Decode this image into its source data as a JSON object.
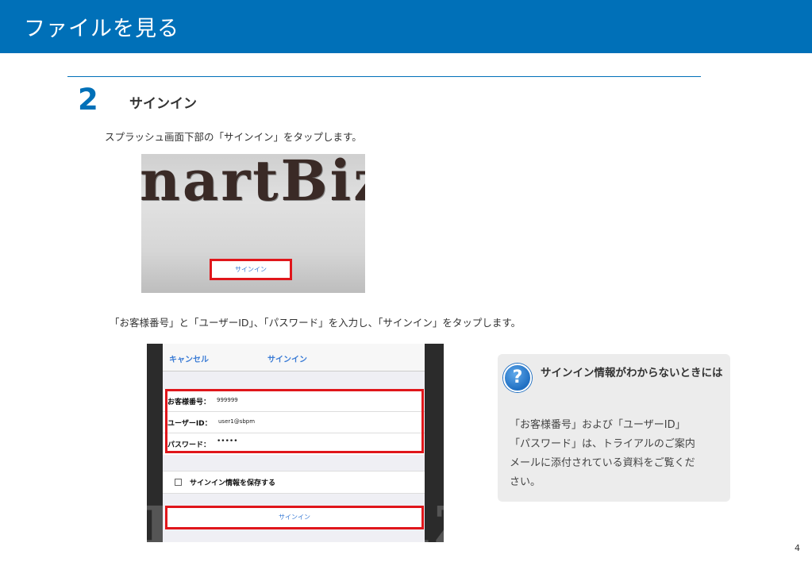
{
  "header": {
    "title": "ファイルを見る"
  },
  "step": {
    "number": "2",
    "title": "サインイン"
  },
  "para1": "スプラッシュ画面下部の「サインイン」をタップします。",
  "splash": {
    "logo_text": "nartBiz",
    "signin_label": "サインイン"
  },
  "para2": "「お客様番号」と「ユーザーID」、「パスワード」を入力し、「サインイン」をタップします。",
  "signin_screen": {
    "cancel": "キャンセル",
    "title": "サインイン",
    "customer_label": "お客様番号：",
    "customer_value": "999999",
    "user_label": "ユーザーID：",
    "user_value": "user1@sbpm",
    "password_label": "パスワード：",
    "password_value": "•••••",
    "remember_label": "サインイン情報を保存する",
    "signin_button": "サインイン",
    "bg_text": "nartBiz"
  },
  "help": {
    "icon": "question-icon",
    "icon_glyph": "?",
    "title": "サインイン情報がわからないときには",
    "body_lines": [
      "「お客様番号」および「ユーザーID」",
      "「パスワード」は、トライアルのご案内",
      "メールに添付されている資料をご覧くだ",
      "さい。"
    ]
  },
  "page_number": "4",
  "colors": {
    "brand": "#0070b8",
    "highlight": "#e0161b",
    "link": "#3a7bd5"
  }
}
